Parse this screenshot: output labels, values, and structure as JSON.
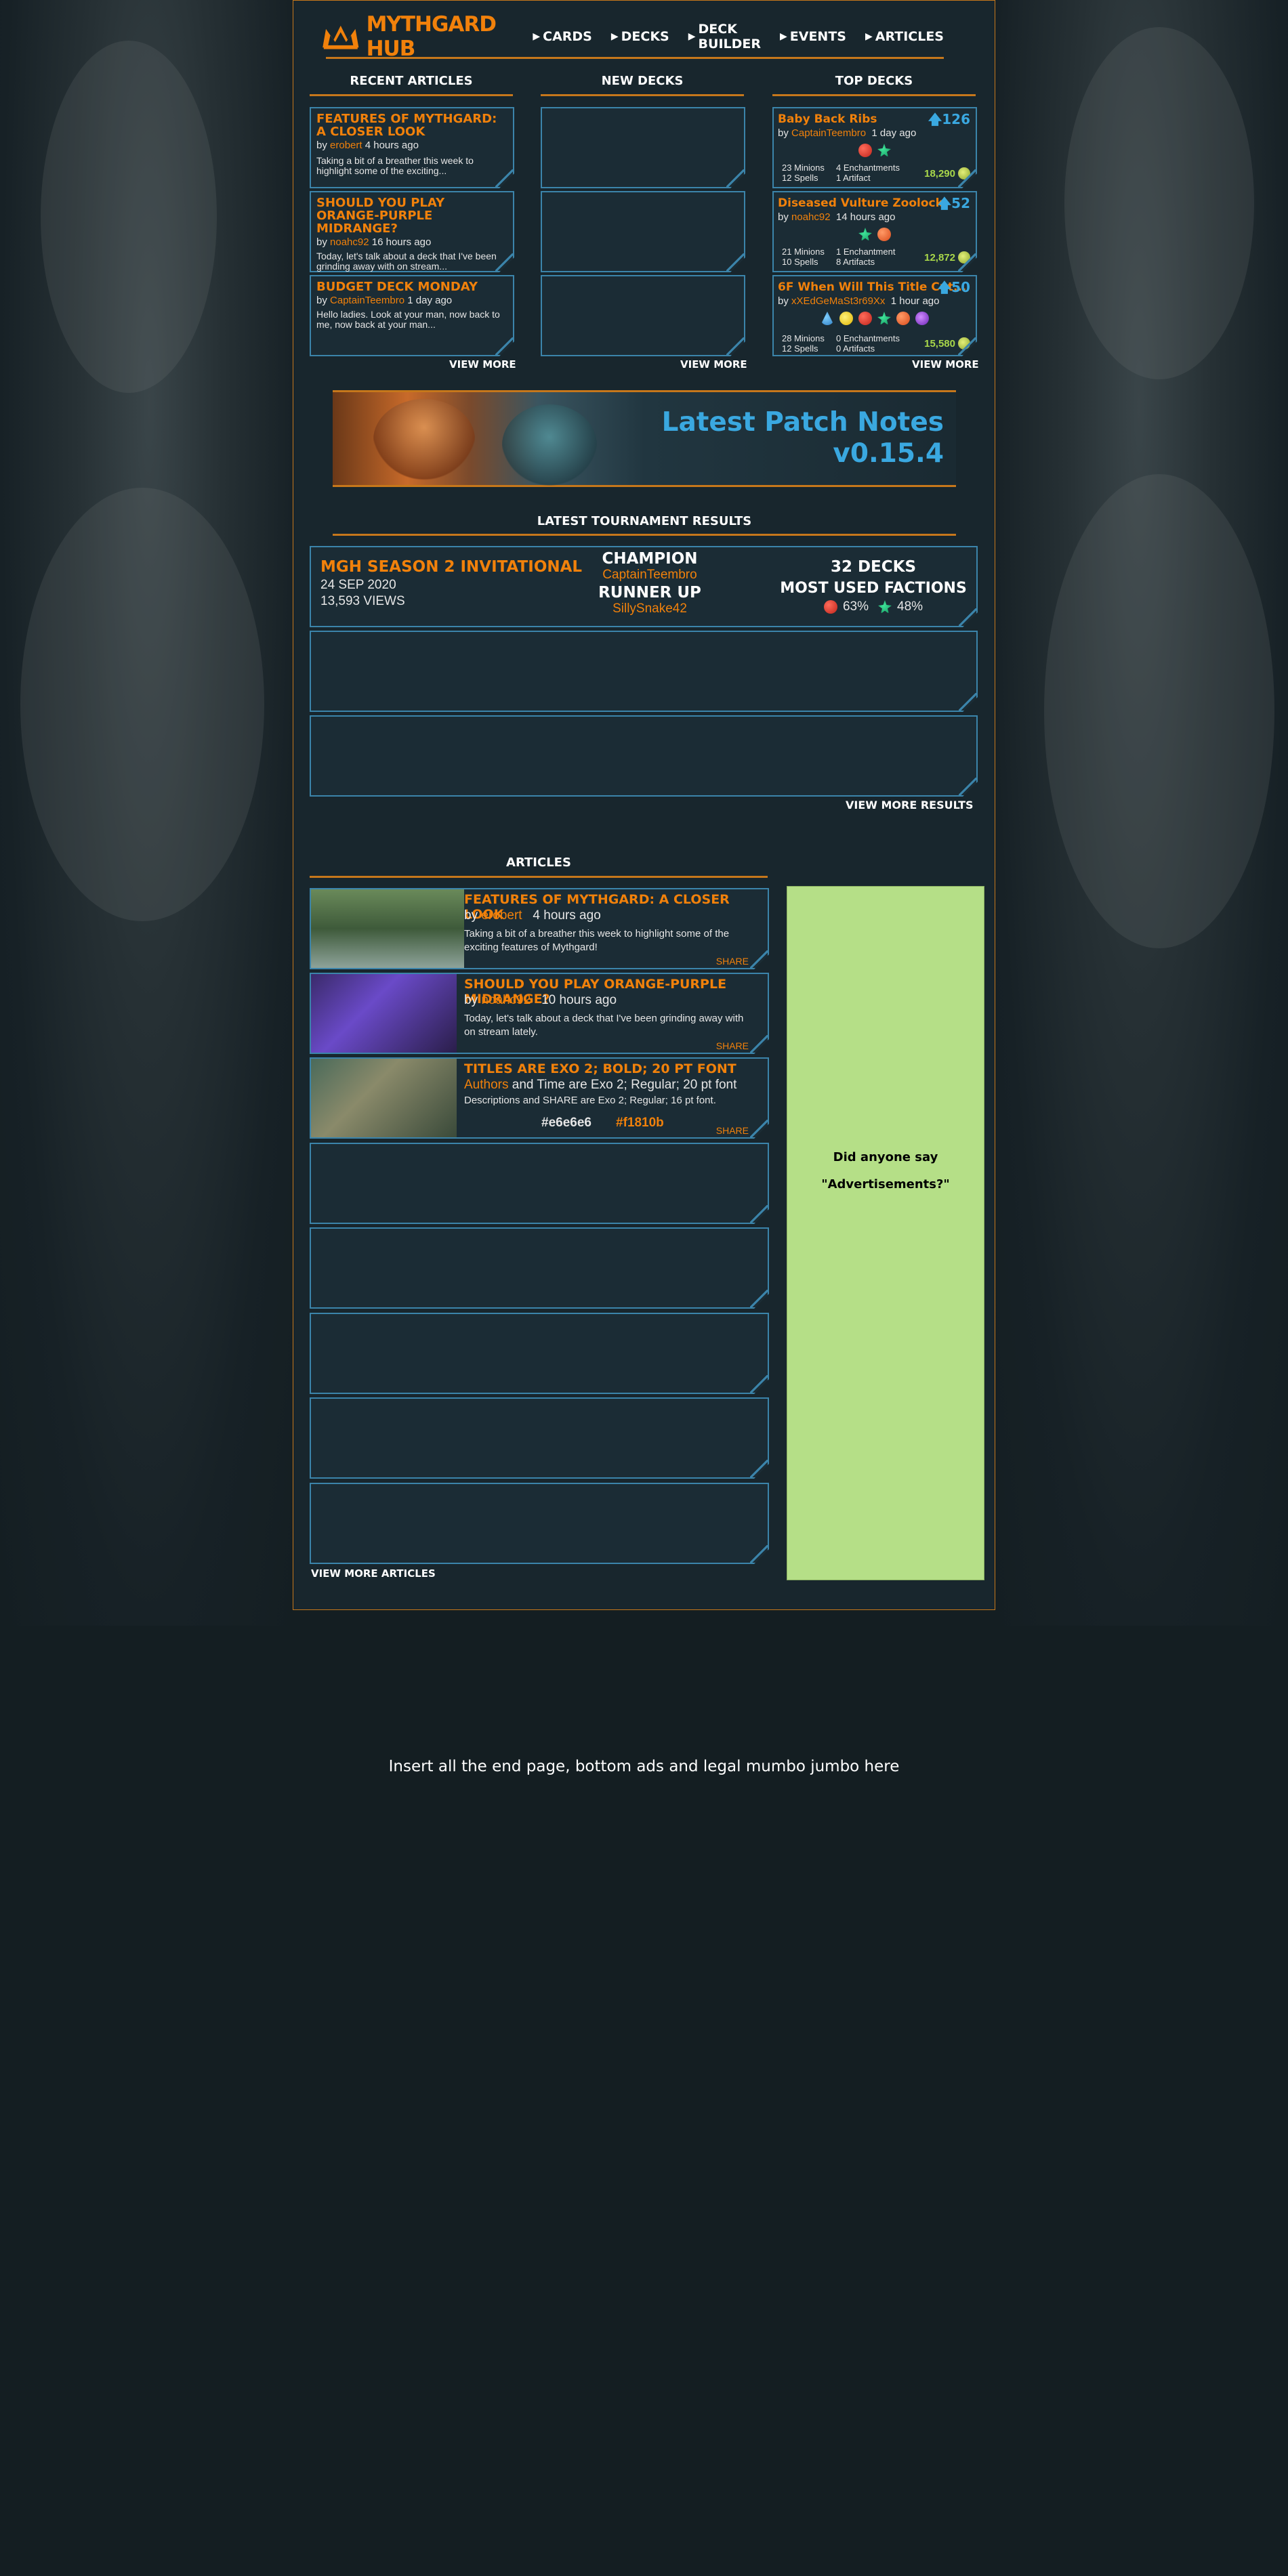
{
  "nav": {
    "brand": "MYTHGARD HUB",
    "items": [
      {
        "label": "CARDS"
      },
      {
        "label": "DECKS"
      },
      {
        "label": "DECK BUILDER"
      },
      {
        "label": "EVENTS"
      },
      {
        "label": "ARTICLES"
      }
    ]
  },
  "recent": {
    "title": "RECENT ARTICLES",
    "view_more": "VIEW MORE",
    "items": [
      {
        "title": "FEATURES OF MYTHGARD: A CLOSER LOOK",
        "by": "by",
        "author": "erobert",
        "time": "4 hours ago",
        "snippet": "Taking a bit of a breather this week to highlight some of the exciting..."
      },
      {
        "title": "SHOULD YOU PLAY ORANGE-PURPLE MIDRANGE?",
        "by": "by",
        "author": "noahc92",
        "time": "16 hours ago",
        "snippet": "Today, let's talk about a deck that I've been grinding away with on stream..."
      },
      {
        "title": "BUDGET DECK MONDAY",
        "by": "by",
        "author": "CaptainTeembro",
        "time": "1 day ago",
        "snippet": "Hello ladies. Look at your man, now back to me, now back at your man..."
      }
    ]
  },
  "newdecks": {
    "title": "NEW DECKS",
    "view_more": "VIEW MORE"
  },
  "topdecks": {
    "title": "TOP DECKS",
    "view_more": "VIEW MORE",
    "items": [
      {
        "name": "Baby Back Ribs",
        "by": "by",
        "author": "CaptainTeembro",
        "time": "1 day ago",
        "votes": "126",
        "minions": "23 Minions",
        "spells": "12 Spells",
        "ench": "4 Enchantments",
        "arts": "1 Artifact",
        "essence": "18,290",
        "factions": [
          "red",
          "green"
        ]
      },
      {
        "name": "Diseased Vulture Zoolock",
        "by": "by",
        "author": "noahc92",
        "time": "14 hours ago",
        "votes": "52",
        "minions": "21 Minions",
        "spells": "10 Spells",
        "ench": "1 Enchantment",
        "arts": "8 Artifacts",
        "essence": "12,872",
        "factions": [
          "green",
          "orng"
        ]
      },
      {
        "name": "6F When Will This Title Cut...",
        "by": "by",
        "author": "xXEdGeMaSt3r69Xx",
        "time": "1 hour ago",
        "votes": "50",
        "minions": "28 Minions",
        "spells": "12 Spells",
        "ench": "0 Enchantments",
        "arts": "0 Artifacts",
        "essence": "15,580",
        "factions": [
          "blue",
          "yellow",
          "red",
          "green",
          "orng",
          "purple"
        ]
      }
    ]
  },
  "patch": {
    "line1": "Latest Patch Notes",
    "line2": "v0.15.4"
  },
  "tournament": {
    "title": "LATEST TOURNAMENT RESULTS",
    "name": "MGH SEASON 2 INVITATIONAL",
    "date": "24 SEP 2020",
    "views": "13,593 VIEWS",
    "champion_label": "CHAMPION",
    "champion": "CaptainTeembro",
    "runner_label": "RUNNER UP",
    "runner": "SillySnake42",
    "decks": "32 DECKS",
    "factions_label": "MOST USED FACTIONS",
    "f1": "63%",
    "f2": "48%",
    "view_more": "VIEW MORE RESULTS"
  },
  "articles": {
    "title": "ARTICLES",
    "view_more": "VIEW MORE ARTICLES",
    "items": [
      {
        "title": "FEATURES OF MYTHGARD: A CLOSER LOOK",
        "by": "by",
        "author": "erobert",
        "time": "4 hours ago",
        "body": "Taking a bit of a breather this week to highlight some of the exciting features of Mythgard!",
        "share": "SHARE"
      },
      {
        "title": "SHOULD YOU PLAY ORANGE-PURPLE MIDRANGE?",
        "by": "by",
        "author": "noahc92",
        "time": "10 hours ago",
        "body": "Today, let's talk about a deck that I've been grinding away with on stream lately.",
        "share": "SHARE"
      },
      {
        "title": "TITLES ARE EXO 2; BOLD; 20 PT FONT",
        "author": "Authors",
        "rest": "and Time are Exo 2; Regular; 20 pt font",
        "body": "Descriptions and SHARE are Exo 2; Regular; 16 pt font.",
        "c1": "#e6e6e6",
        "c2": "#f1810b",
        "share": "SHARE"
      }
    ]
  },
  "ad": {
    "line1": "Did anyone say",
    "line2": "\"Advertisements?\""
  },
  "footer": {
    "text": "Insert all the end page, bottom ads and legal mumbo jumbo here"
  },
  "colors": {
    "accent": "#f1810b",
    "text": "#e6e6e6",
    "border": "#3b84aa",
    "ad": "#b5df87"
  }
}
